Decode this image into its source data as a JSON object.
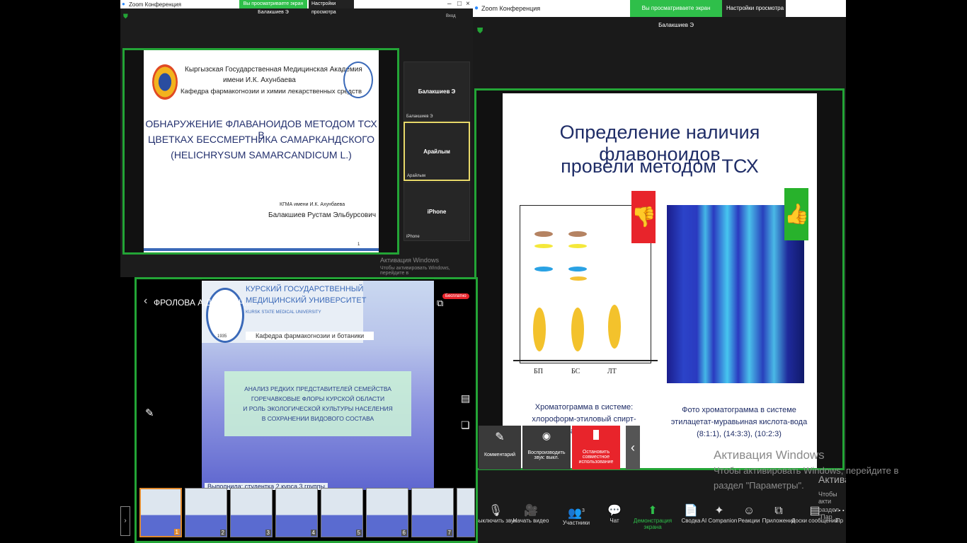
{
  "left_window": {
    "title": "Zoom Конференция",
    "viewing_banner": "Вы просматриваете экран Балакшиев Э",
    "view_options": "Настройки просмотра",
    "exit_label": "Вход",
    "slide": {
      "academy_line1": "Кыргызская Государственная Медицинская Академия",
      "academy_line2": "имени И.К. Ахунбаева",
      "academy_line3": "Кафедра фармакогнозии и химии лекарственных средств",
      "title_line1": "ОБНАРУЖЕНИЕ ФЛАВАНОИДОВ МЕТОДОМ ТСХ В",
      "title_line2": "ЦВЕТКАХ БЕССМЕРТНИКА САМАРКАНДСКОГО",
      "title_line3": "(HELICHRYSUM SAMARCANDICUM L.)",
      "org": "КГМА имени И.К. Ахунбаева",
      "author": "Балакшиев Рустам Эльбурсович",
      "page": "1"
    },
    "participants": [
      {
        "name": "Балакшиев Э",
        "label": "Балакшиев Э"
      },
      {
        "name": "Арайлым",
        "label": "Арайлым"
      },
      {
        "name": "iPhone",
        "label": "iPhone"
      }
    ],
    "activation_title": "Активация Windows",
    "activation_text": "Чтобы активировать Windows, перейдите в"
  },
  "right_window": {
    "title": "Zoom Конференция",
    "viewing_banner": "Вы просматриваете экран Балакшиев Э",
    "view_options": "Настройки просмотра",
    "slide": {
      "title_line1": "Определение наличия флавоноидов",
      "title_line2": "провели методом ТСХ",
      "lanes": [
        "БП",
        "БС",
        "ЛТ"
      ],
      "caption_left": "Хроматограмма в системе: хлороформ-этиловый спирт-вода (26:16:3).",
      "caption_right": "Фото хроматограмма в системе этилацетат-муравьиная кислота-вода (8:1:1), (14:3:3), (10:2:3)"
    },
    "share_controls": [
      {
        "label": "Комментарий",
        "icon": "pen-icon"
      },
      {
        "label": "Воспроизводить звук: выкл.",
        "icon": "sound-icon"
      },
      {
        "label": "Остановить совместное использование",
        "icon": "stop-icon"
      }
    ],
    "collapse_arrow": "‹",
    "activation_title": "Активация Windows",
    "activation_text1": "Чтобы активировать Windows, перейдите в",
    "activation_text2": "раздел \"Параметры\".",
    "activation_clip1": "Активац",
    "activation_clip2": "Чтобы акти",
    "activation_clip3": "раздел \"Пар",
    "toolbar": [
      {
        "label": "Выключить звук",
        "icon": "🎙"
      },
      {
        "label": "Начать видео",
        "icon": "🎥"
      },
      {
        "label": "Участники",
        "icon": "👥"
      },
      {
        "label": "Чат",
        "icon": "💬"
      },
      {
        "label": "Демонстрация экрана",
        "icon": "⬆"
      },
      {
        "label": "Сводка",
        "icon": "📄"
      },
      {
        "label": "AI Companion",
        "icon": "✦"
      },
      {
        "label": "Реакции",
        "icon": "☺"
      },
      {
        "label": "Приложения",
        "icon": "⧉"
      },
      {
        "label": "Доски сообщений",
        "icon": "▤"
      },
      {
        "label": "Пр",
        "icon": "⋯"
      }
    ],
    "participants_count": "3"
  },
  "phone_window": {
    "back_label": "ФРОЛОВА А.Д.-ГОРЕЧ...",
    "free_badge": "Бесплатно",
    "slide": {
      "uni_line1": "КУРСКИЙ ГОСУДАРСТВЕННЫЙ",
      "uni_line2": "МЕДИЦИНСКИЙ УНИВЕРСИТЕТ",
      "uni_en": "KURSK STATE MEDICAL UNIVERSITY",
      "dept": "Кафедра фармакогнозии и ботаники",
      "year": "1935",
      "title_line1": "АНАЛИЗ РЕДКИХ ПРЕДСТАВИТЕЛЕЙ СЕМЕЙСТВА",
      "title_line2": "ГОРЕЧАВКОВЫЕ ФЛОРЫ КУРСКОЙ ОБЛАСТИ",
      "title_line3": "И РОЛЬ ЭКОЛОГИЧЕСКОЙ КУЛЬТУРЫ НАСЕЛЕНИЯ",
      "title_line4": "В СОХРАНЕНИИ ВИДОВОГО СОСТАВА",
      "footer": "Выполнила: студентка 2 курса 3 группы"
    },
    "thumbnails": [
      "1",
      "2",
      "3",
      "4",
      "5",
      "6",
      "7"
    ]
  },
  "colors": {
    "accent_green": "#23a436",
    "zoom_green": "#2fbf4a",
    "stop_red": "#e8242b"
  }
}
